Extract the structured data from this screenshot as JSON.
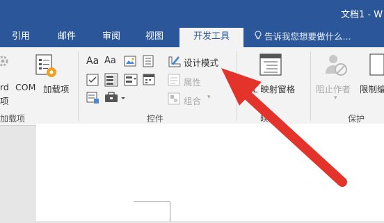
{
  "title": {
    "text": "文档1 - W"
  },
  "tabs": [
    {
      "label": "引用"
    },
    {
      "label": "邮件"
    },
    {
      "label": "审阅"
    },
    {
      "label": "视图"
    },
    {
      "label": "开发工具"
    }
  ],
  "tell_me": {
    "text": "告诉我您想要做什么..."
  },
  "code_group": {
    "partial_label": "rd",
    "partial_label2": "项",
    "group_label": "加载项"
  },
  "addins": {
    "com_label": "COM",
    "addins_label": "加载项"
  },
  "controls_group": {
    "aa1": "Aa",
    "aa2": "Aa",
    "design_mode": "设计模式",
    "properties": "属性",
    "group": "组合",
    "label": "控件"
  },
  "mapping_group": {
    "xml_label": "XML 映射窗格",
    "label": "映射"
  },
  "protect_group": {
    "block_authors": "阻止作者",
    "restrict_editing": "限制编辑",
    "label": "保护"
  },
  "colors": {
    "accent": "#2b579a",
    "arrow": "#e3332b"
  }
}
